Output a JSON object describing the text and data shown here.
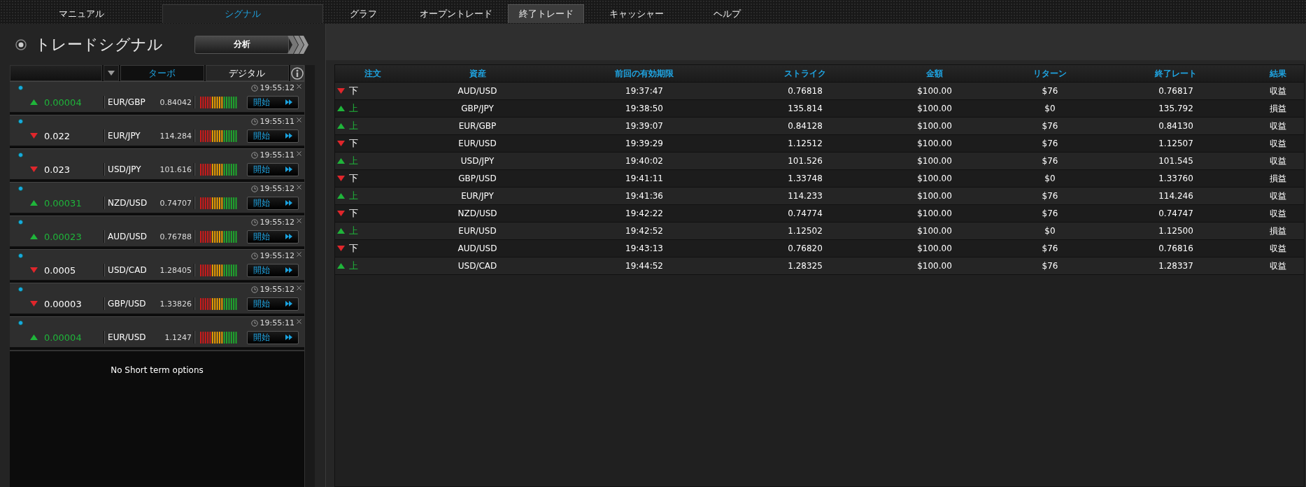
{
  "nav": {
    "tabs": [
      {
        "label": "マニュアル",
        "selected": false,
        "highlighted": false
      },
      {
        "label": "シグナル",
        "selected": false,
        "highlighted": true
      },
      {
        "label": "グラフ",
        "selected": false,
        "highlighted": false
      },
      {
        "label": "オープントレード",
        "selected": false,
        "highlighted": false
      },
      {
        "label": "終了トレード",
        "selected": true,
        "highlighted": false
      },
      {
        "label": "キャッシャー",
        "selected": false,
        "highlighted": false
      },
      {
        "label": "ヘルプ",
        "selected": false,
        "highlighted": false
      }
    ]
  },
  "signals_panel": {
    "title": "トレードシグナル",
    "analyze_button": "分析",
    "filter_tabs": [
      {
        "label": "ターボ",
        "selected": true
      },
      {
        "label": "デジタル",
        "selected": false
      }
    ],
    "signals": [
      {
        "rising": true,
        "change": "0.00004",
        "pair": "EUR/GBP",
        "price": "0.84042",
        "time": "19:55:12",
        "button": "開始"
      },
      {
        "rising": false,
        "change": "0.022",
        "pair": "EUR/JPY",
        "price": "114.284",
        "time": "19:55:11",
        "button": "開始"
      },
      {
        "rising": false,
        "change": "0.023",
        "pair": "USD/JPY",
        "price": "101.616",
        "time": "19:55:11",
        "button": "開始"
      },
      {
        "rising": true,
        "change": "0.00031",
        "pair": "NZD/USD",
        "price": "0.74707",
        "time": "19:55:12",
        "button": "開始"
      },
      {
        "rising": true,
        "change": "0.00023",
        "pair": "AUD/USD",
        "price": "0.76788",
        "time": "19:55:12",
        "button": "開始"
      },
      {
        "rising": false,
        "change": "0.0005",
        "pair": "USD/CAD",
        "price": "1.28405",
        "time": "19:55:12",
        "button": "開始"
      },
      {
        "rising": false,
        "change": "0.00003",
        "pair": "GBP/USD",
        "price": "1.33826",
        "time": "19:55:12",
        "button": "開始"
      },
      {
        "rising": true,
        "change": "0.00004",
        "pair": "EUR/USD",
        "price": "1.1247",
        "time": "19:55:11",
        "button": "開始"
      }
    ],
    "empty_message": "No Short term options"
  },
  "closed_trades": {
    "columns": [
      "注文",
      "資産",
      "前回の有効期限",
      "ストライク",
      "金額",
      "リターン",
      "終了レート",
      "結果"
    ],
    "rows": [
      {
        "rising": false,
        "order": "下",
        "asset": "AUD/USD",
        "expiry": "19:37:47",
        "strike": "0.76818",
        "amount": "$100.00",
        "return": "$76",
        "close_rate": "0.76817",
        "result": "収益"
      },
      {
        "rising": true,
        "order": "上",
        "asset": "GBP/JPY",
        "expiry": "19:38:50",
        "strike": "135.814",
        "amount": "$100.00",
        "return": "$0",
        "close_rate": "135.792",
        "result": "損益"
      },
      {
        "rising": true,
        "order": "上",
        "asset": "EUR/GBP",
        "expiry": "19:39:07",
        "strike": "0.84128",
        "amount": "$100.00",
        "return": "$76",
        "close_rate": "0.84130",
        "result": "収益"
      },
      {
        "rising": false,
        "order": "下",
        "asset": "EUR/USD",
        "expiry": "19:39:29",
        "strike": "1.12512",
        "amount": "$100.00",
        "return": "$76",
        "close_rate": "1.12507",
        "result": "収益"
      },
      {
        "rising": true,
        "order": "上",
        "asset": "USD/JPY",
        "expiry": "19:40:02",
        "strike": "101.526",
        "amount": "$100.00",
        "return": "$76",
        "close_rate": "101.545",
        "result": "収益"
      },
      {
        "rising": false,
        "order": "下",
        "asset": "GBP/USD",
        "expiry": "19:41:11",
        "strike": "1.33748",
        "amount": "$100.00",
        "return": "$0",
        "close_rate": "1.33760",
        "result": "損益"
      },
      {
        "rising": true,
        "order": "上",
        "asset": "EUR/JPY",
        "expiry": "19:41:36",
        "strike": "114.233",
        "amount": "$100.00",
        "return": "$76",
        "close_rate": "114.246",
        "result": "収益"
      },
      {
        "rising": false,
        "order": "下",
        "asset": "NZD/USD",
        "expiry": "19:42:22",
        "strike": "0.74774",
        "amount": "$100.00",
        "return": "$76",
        "close_rate": "0.74747",
        "result": "収益"
      },
      {
        "rising": true,
        "order": "上",
        "asset": "EUR/USD",
        "expiry": "19:42:52",
        "strike": "1.12502",
        "amount": "$100.00",
        "return": "$0",
        "close_rate": "1.12500",
        "result": "損益"
      },
      {
        "rising": false,
        "order": "下",
        "asset": "AUD/USD",
        "expiry": "19:43:13",
        "strike": "0.76820",
        "amount": "$100.00",
        "return": "$76",
        "close_rate": "0.76816",
        "result": "収益"
      },
      {
        "rising": true,
        "order": "上",
        "asset": "USD/CAD",
        "expiry": "19:44:52",
        "strike": "1.28325",
        "amount": "$100.00",
        "return": "$76",
        "close_rate": "1.28337",
        "result": "収益"
      }
    ]
  }
}
